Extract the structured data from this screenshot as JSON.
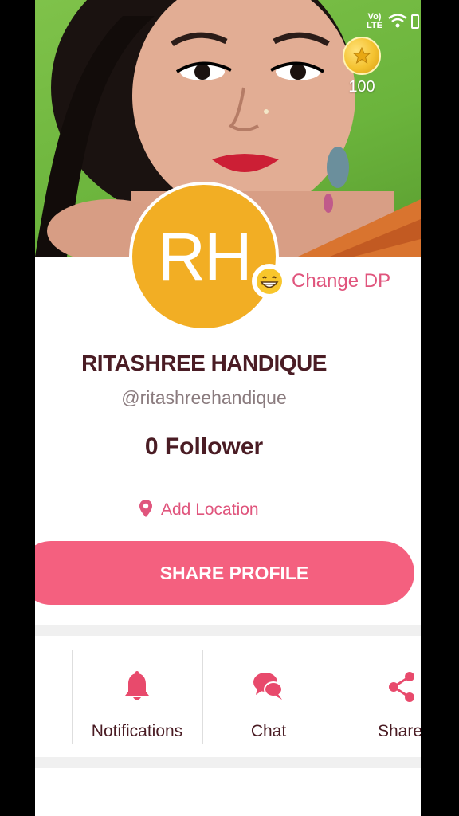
{
  "status_bar": {
    "network": "Vo) LTE"
  },
  "coins": {
    "count": "100"
  },
  "avatar": {
    "initials": "RH"
  },
  "change_dp": {
    "label": "Change DP"
  },
  "profile": {
    "name": "RITASHREE HANDIQUE",
    "handle": "@ritashreehandique",
    "followers": "0 Follower"
  },
  "location": {
    "label": "Add Location"
  },
  "share_profile": {
    "label": "SHARE PROFILE"
  },
  "actions": [
    {
      "label": "Notifications",
      "icon": "bell-icon"
    },
    {
      "label": "Chat",
      "icon": "chat-bubbles-icon"
    },
    {
      "label": "Share",
      "icon": "share-icon"
    }
  ],
  "colors": {
    "accent_pink": "#f4607f",
    "link_pink": "#e0557d",
    "avatar_orange": "#f2ae24",
    "text_dark": "#4a1c24",
    "cover_green": "#6bb43c"
  }
}
